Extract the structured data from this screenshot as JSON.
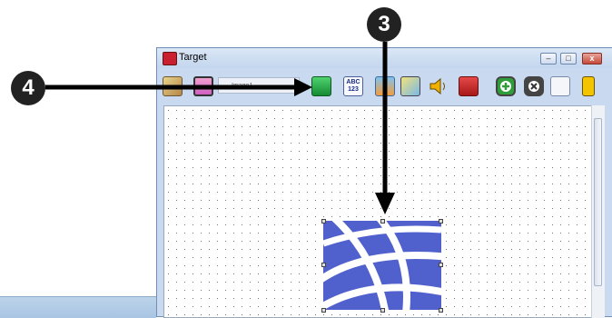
{
  "window": {
    "title": "Target",
    "minimize_label": "–",
    "restore_label": "□",
    "close_label": "x"
  },
  "toolbar": {
    "image_field": "Image1",
    "abc_label": "ABC",
    "num_label": "123"
  },
  "callouts": {
    "three": "3",
    "four": "4"
  },
  "colors": {
    "globe_blue": "#5060cc",
    "arrow": "#000000"
  }
}
